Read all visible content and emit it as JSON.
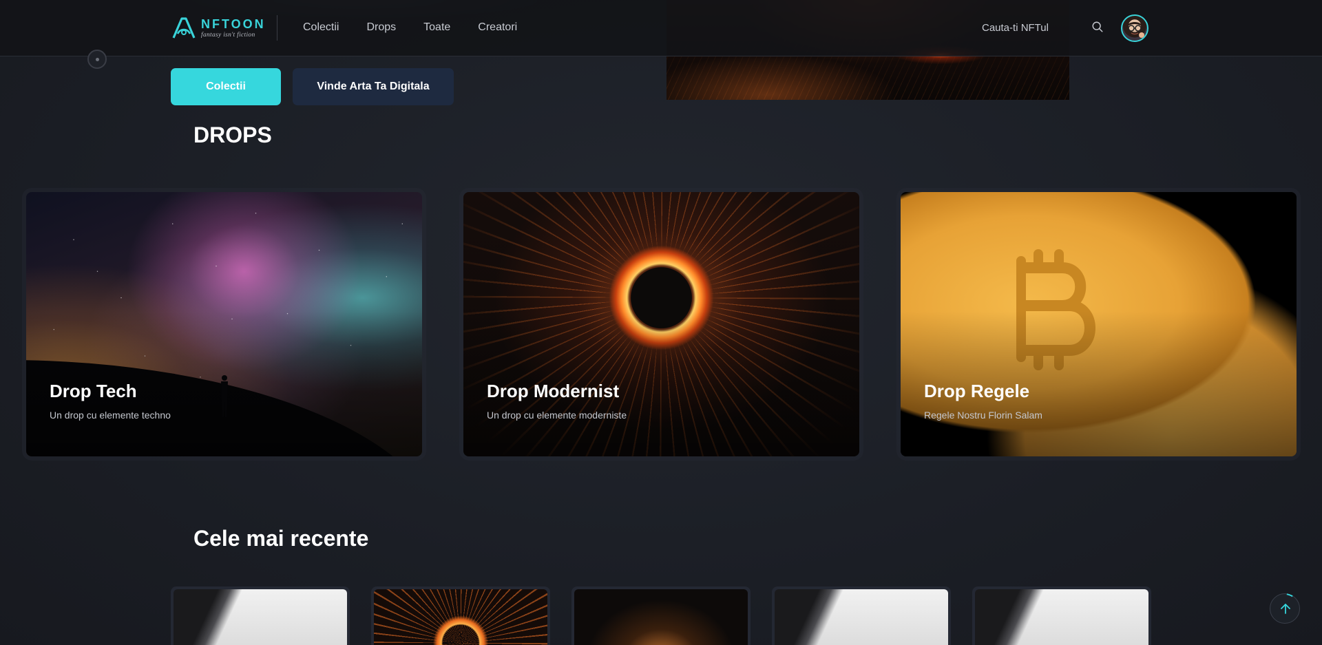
{
  "app": {
    "brand_name": "NFTOON",
    "brand_tagline": "fantasy isn't fiction",
    "accent_color": "#36d7dd"
  },
  "nav": {
    "items": [
      {
        "label": "Colectii"
      },
      {
        "label": "Drops"
      },
      {
        "label": "Toate"
      },
      {
        "label": "Creatori"
      }
    ],
    "search_placeholder": "Cauta-ti NFTul",
    "search_icon": "search-icon",
    "avatar_icon": "avatar"
  },
  "hero": {
    "primary_button": "Colectii",
    "secondary_button": "Vinde Arta Ta Digitala"
  },
  "drops": {
    "title": "DROPS",
    "items": [
      {
        "name": "Drop Tech",
        "description": "Un drop cu elemente techno"
      },
      {
        "name": "Drop Modernist",
        "description": "Un drop cu elemente moderniste"
      },
      {
        "name": "Drop Regele",
        "description": "Regele Nostru Florin Salam"
      }
    ]
  },
  "recent": {
    "title": "Cele mai recente"
  },
  "scroll_top_icon": "arrow-up-icon"
}
